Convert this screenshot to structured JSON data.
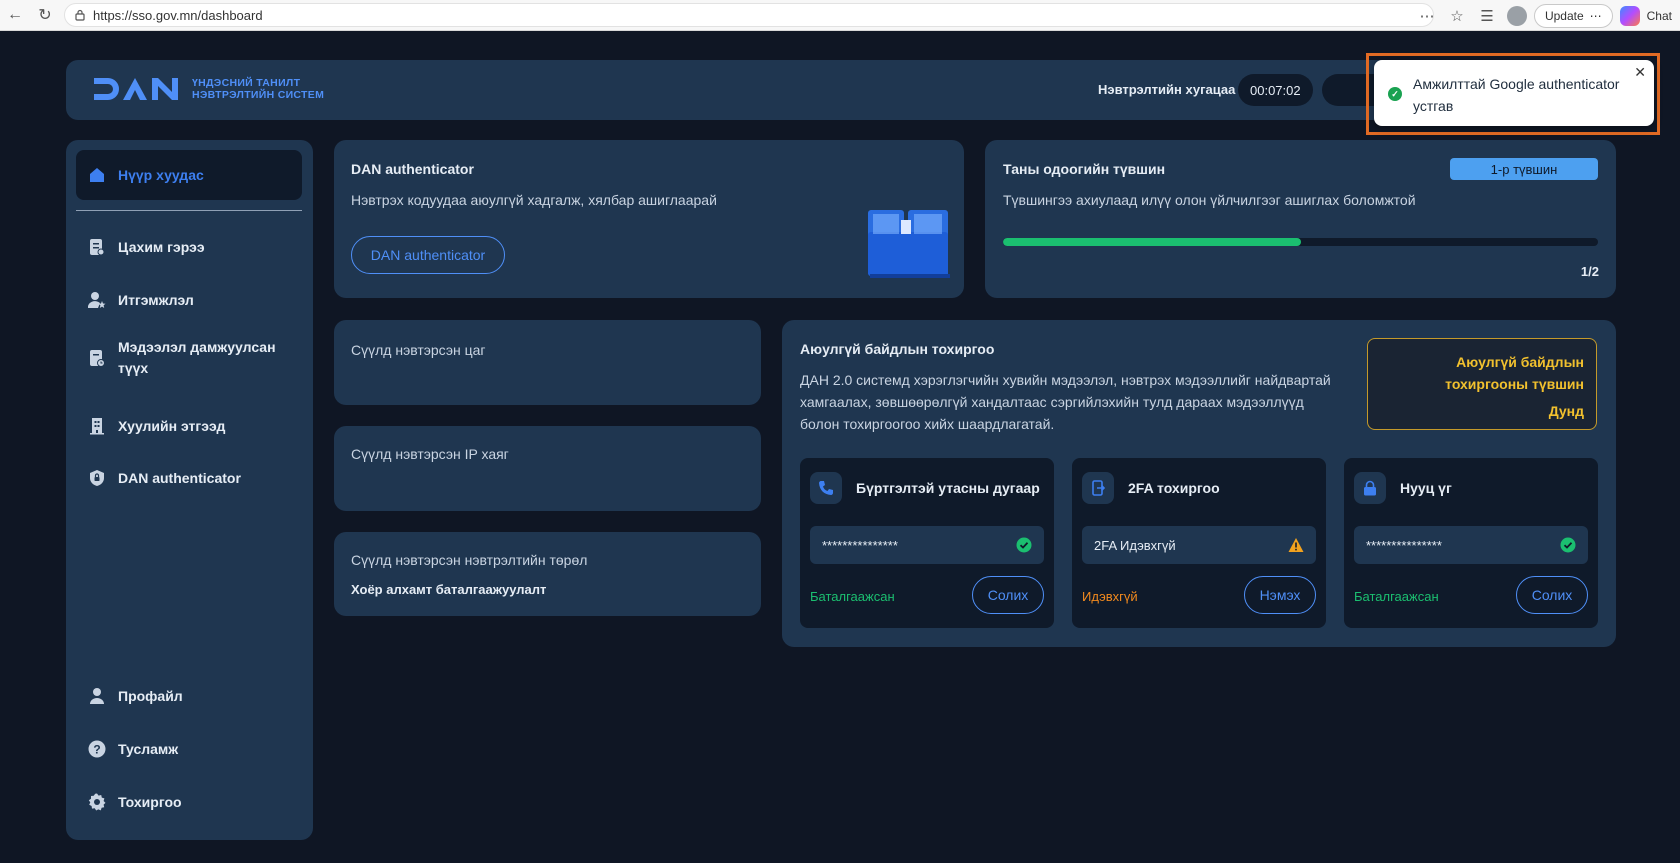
{
  "browser": {
    "url": "https://sso.gov.mn/dashboard",
    "update_label": "Update",
    "chat_label": "Chat"
  },
  "header": {
    "logo_line1": "ҮНДЭСНИЙ ТАНИЛТ",
    "logo_line2": "НЭВТРЭЛТИЙН СИСТЕМ",
    "session_label": "Нэвтрэлтийн хугацаа",
    "timer": "00:07:02"
  },
  "toast": {
    "message": "Амжилттай Google authenticator устгав"
  },
  "sidebar": {
    "items": [
      {
        "label": "Нүүр хуудас"
      },
      {
        "label": "Цахим гэрээ"
      },
      {
        "label": "Итгэмжлэл"
      },
      {
        "label": "Мэдээлэл дамжуулсан түүх"
      },
      {
        "label": "Хуулийн этгээд"
      },
      {
        "label": "DAN authenticator"
      }
    ],
    "bottom_items": [
      {
        "label": "Профайл"
      },
      {
        "label": "Тусламж"
      },
      {
        "label": "Тохиргоо"
      }
    ]
  },
  "authenticator_card": {
    "title": "DAN authenticator",
    "text": "Нэвтрэх кодуудаа аюулгүй хадгалж, хялбар ашиглаарай",
    "button": "DAN authenticator"
  },
  "level_card": {
    "title": "Таны одоогийн түвшин",
    "badge": "1-р түвшин",
    "text": "Түвшингээ ахиулаад илүү олон үйлчилгээг ашиглах боломжтой",
    "progress_fraction": 0.5,
    "progress_text": "1/2"
  },
  "last_login_time": {
    "title": "Сүүлд нэвтэрсэн цаг"
  },
  "last_ip": {
    "title": "Сүүлд нэвтэрсэн IP хаяг"
  },
  "last_login_type": {
    "title": "Сүүлд нэвтэрсэн нэвтрэлтийн төрөл",
    "value": "Хоёр алхамт баталгаажуулалт"
  },
  "security": {
    "title": "Аюулгүй байдлын тохиргоо",
    "description": "ДАН 2.0 системд хэрэглэгчийн хувийн мэдээлэл, нэвтрэх мэдээллийг найдвартай хамгаалах, зөвшөөрөлгүй хандалтаас сэргийлэхийн тулд дараах мэдээллүүд болон тохиргоогоо хийх шаардлагатай.",
    "level_label": "Аюулгүй байдлын тохиргооны түвшин",
    "level_value": "Дунд",
    "phone": {
      "title": "Бүртгэлтэй утасны дугаар",
      "value": "***************",
      "status": "Баталгаажсан",
      "button": "Солих"
    },
    "twofa": {
      "title": "2FA тохиргоо",
      "value": "2FA Идэвхгүй",
      "status": "Идэвхгүй",
      "button": "Нэмэх"
    },
    "password": {
      "title": "Нууц үг",
      "value": "***************",
      "status": "Баталгаажсан",
      "button": "Солих"
    }
  },
  "colors": {
    "accent": "#4f8ff7",
    "success": "#1bbf70",
    "warning": "#f2a21e",
    "panel": "#1f3650",
    "background": "#0f1624"
  }
}
